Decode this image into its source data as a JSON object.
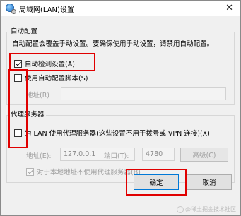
{
  "window": {
    "title": "局域网(LAN)设置",
    "close_glyph": "✕"
  },
  "auto_config": {
    "group_label": "自动配置",
    "description": "自动配置会覆盖手动设置。要确保使用手动设置，请禁用自动配置。",
    "auto_detect": {
      "label": "自动检测设置(A)",
      "checked": true
    },
    "use_script": {
      "label": "使用自动配置脚本(S)",
      "checked": false
    },
    "address_label": "地址(R)",
    "address_value": ""
  },
  "proxy": {
    "group_label": "代理服务器",
    "use_proxy": {
      "label": "为 LAN 使用代理服务器(这些设置不用于拨号或 VPN 连接)(X)",
      "checked": false
    },
    "address_label": "地址(E):",
    "address_value": "127.0.0.1",
    "port_label": "端口(T):",
    "port_value": "4780",
    "advanced_label": "高级(C)",
    "bypass_local": {
      "label": "对于本地地址不使用代理服务器(B)",
      "checked": true
    }
  },
  "buttons": {
    "ok_label": "确定",
    "cancel_label": "取消"
  },
  "watermark": {
    "text": "@稀土掘金技术社区"
  },
  "colors": {
    "annotation_red": "#e00000",
    "dialog_bg": "#f0f0f0",
    "disabled_text": "#a0a0a0"
  }
}
